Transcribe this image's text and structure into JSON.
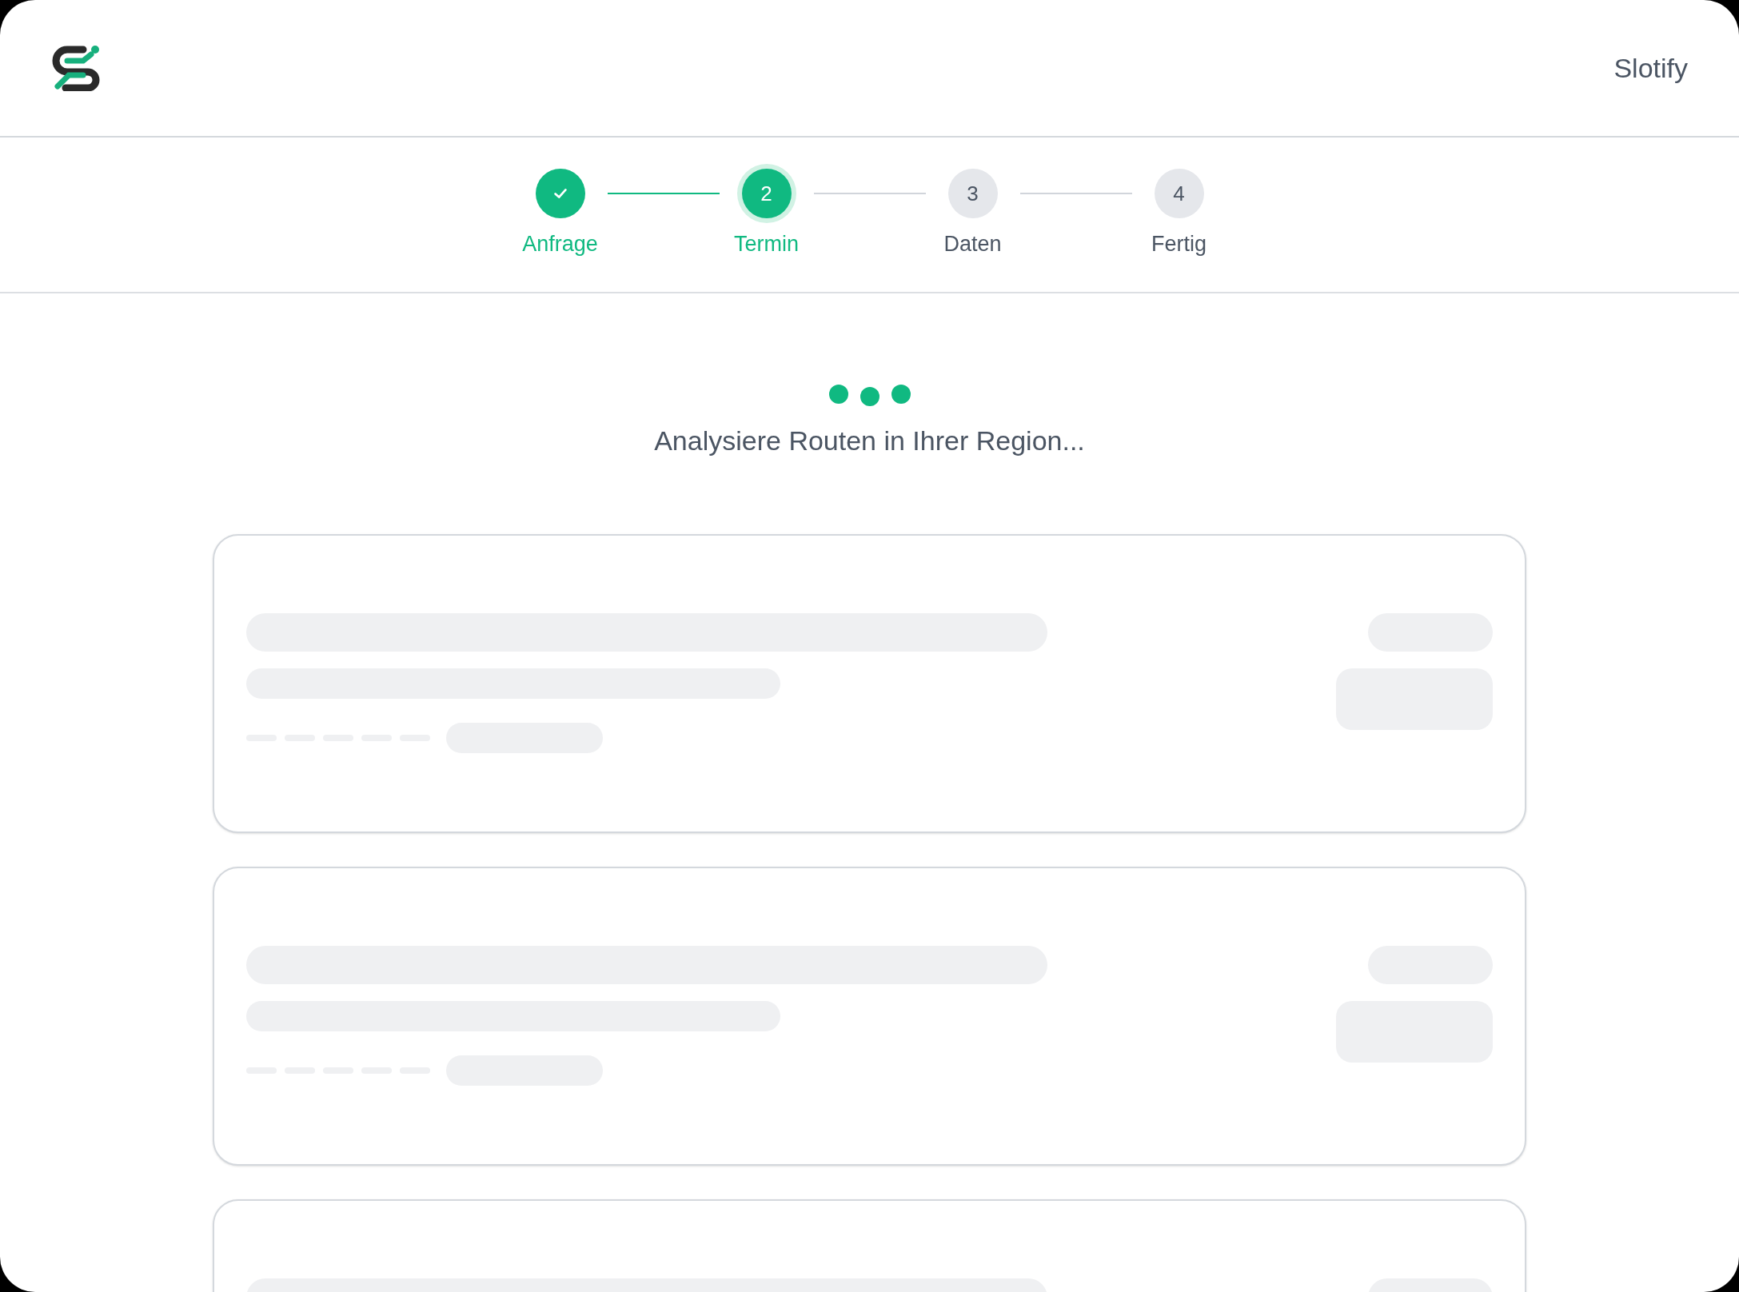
{
  "header": {
    "brand": "Slotify"
  },
  "steps": [
    {
      "label": "Anfrage",
      "kind": "done"
    },
    {
      "number": "2",
      "label": "Termin",
      "kind": "current"
    },
    {
      "number": "3",
      "label": "Daten",
      "kind": "upcoming"
    },
    {
      "number": "4",
      "label": "Fertig",
      "kind": "upcoming"
    }
  ],
  "loading": {
    "message": "Analysiere Routen in Ihrer Region..."
  }
}
